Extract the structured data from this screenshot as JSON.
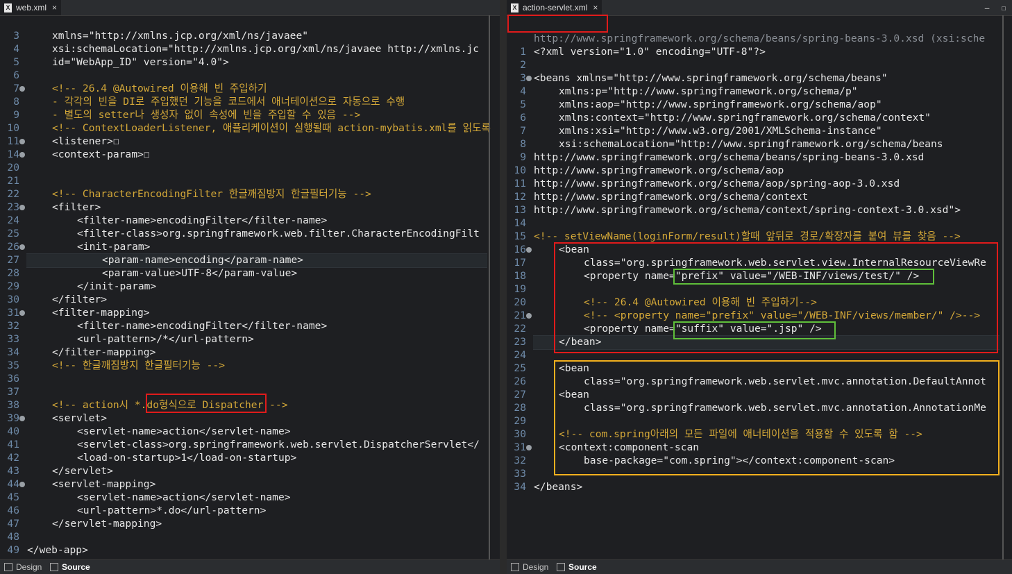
{
  "left": {
    "tab": {
      "label": "web.xml",
      "close": "×"
    },
    "bottom_tabs": {
      "design": "Design",
      "source": "Source"
    },
    "lines": [
      {
        "n": "3",
        "fold": false,
        "indent": 4,
        "text": "xmlns=\"http://xmlns.jcp.org/xml/ns/javaee\"",
        "kind": "tag"
      },
      {
        "n": "4",
        "fold": false,
        "indent": 4,
        "text": "xsi:schemaLocation=\"http://xmlns.jcp.org/xml/ns/javaee http://xmlns.jc",
        "kind": "tag"
      },
      {
        "n": "5",
        "fold": false,
        "indent": 4,
        "text": "id=\"WebApp_ID\" version=\"4.0\">",
        "kind": "tag"
      },
      {
        "n": "6",
        "fold": false,
        "indent": 0,
        "text": "",
        "kind": "tag"
      },
      {
        "n": "7",
        "fold": true,
        "indent": 4,
        "text": "<!-- 26.4 @Autowired 이용해 빈 주입하기",
        "kind": "cmt"
      },
      {
        "n": "8",
        "fold": false,
        "indent": 4,
        "text": "- 각각의 빈을 DI로 주입했던 기능을 코드에서 애너테이션으로 자동으로 수행",
        "kind": "cmt"
      },
      {
        "n": "9",
        "fold": false,
        "indent": 4,
        "text": "- 별도의 setter나 생성자 없이 속성에 빈을 주입할 수 있음 -->",
        "kind": "cmt"
      },
      {
        "n": "10",
        "fold": false,
        "indent": 4,
        "text": "<!-- ContextLoaderListener, 애플리케이션이 실행될때 action-mybatis.xml를 읽도록",
        "kind": "cmt"
      },
      {
        "n": "11",
        "fold": "plus",
        "indent": 4,
        "text": "<listener>☐",
        "kind": "tag"
      },
      {
        "n": "14",
        "fold": "plus",
        "indent": 4,
        "text": "<context-param>☐",
        "kind": "tag"
      },
      {
        "n": "20",
        "fold": false,
        "indent": 0,
        "text": "",
        "kind": "tag"
      },
      {
        "n": "21",
        "fold": false,
        "indent": 0,
        "text": "",
        "kind": "tag"
      },
      {
        "n": "22",
        "fold": false,
        "indent": 4,
        "text": "<!-- CharacterEncodingFilter 한글깨짐방지 한글필터기능 -->",
        "kind": "cmt"
      },
      {
        "n": "23",
        "fold": true,
        "indent": 4,
        "text": "<filter>",
        "kind": "tag"
      },
      {
        "n": "24",
        "fold": false,
        "indent": 8,
        "text": "<filter-name>encodingFilter</filter-name>",
        "kind": "tag"
      },
      {
        "n": "25",
        "fold": false,
        "indent": 8,
        "text": "<filter-class>org.springframework.web.filter.CharacterEncodingFilt",
        "kind": "tag"
      },
      {
        "n": "26",
        "fold": true,
        "indent": 8,
        "text": "<init-param>",
        "kind": "tag"
      },
      {
        "n": "27",
        "fold": false,
        "indent": 12,
        "text": "<param-name>encoding</param-name>",
        "kind": "tag",
        "current": true
      },
      {
        "n": "28",
        "fold": false,
        "indent": 12,
        "text": "<param-value>UTF-8</param-value>",
        "kind": "tag"
      },
      {
        "n": "29",
        "fold": false,
        "indent": 8,
        "text": "</init-param>",
        "kind": "tag"
      },
      {
        "n": "30",
        "fold": false,
        "indent": 4,
        "text": "</filter>",
        "kind": "tag"
      },
      {
        "n": "31",
        "fold": true,
        "indent": 4,
        "text": "<filter-mapping>",
        "kind": "tag"
      },
      {
        "n": "32",
        "fold": false,
        "indent": 8,
        "text": "<filter-name>encodingFilter</filter-name>",
        "kind": "tag"
      },
      {
        "n": "33",
        "fold": false,
        "indent": 8,
        "text": "<url-pattern>/*</url-pattern>",
        "kind": "tag"
      },
      {
        "n": "34",
        "fold": false,
        "indent": 4,
        "text": "</filter-mapping>",
        "kind": "tag"
      },
      {
        "n": "35",
        "fold": false,
        "indent": 4,
        "text": "<!-- 한글깨짐방지 한글필터기능 -->",
        "kind": "cmt"
      },
      {
        "n": "36",
        "fold": false,
        "indent": 0,
        "text": "",
        "kind": "tag"
      },
      {
        "n": "37",
        "fold": false,
        "indent": 0,
        "text": "",
        "kind": "tag"
      },
      {
        "n": "38",
        "fold": false,
        "indent": 4,
        "text": "<!-- action시 *.do형식으로 Dispatcher -->",
        "kind": "cmt"
      },
      {
        "n": "39",
        "fold": true,
        "indent": 4,
        "text": "<servlet>",
        "kind": "tag"
      },
      {
        "n": "40",
        "fold": false,
        "indent": 8,
        "text": "<servlet-name>action</servlet-name>",
        "kind": "tag"
      },
      {
        "n": "41",
        "fold": false,
        "indent": 8,
        "text": "<servlet-class>org.springframework.web.servlet.DispatcherServlet</",
        "kind": "tag"
      },
      {
        "n": "42",
        "fold": false,
        "indent": 8,
        "text": "<load-on-startup>1</load-on-startup>",
        "kind": "tag"
      },
      {
        "n": "43",
        "fold": false,
        "indent": 4,
        "text": "</servlet>",
        "kind": "tag"
      },
      {
        "n": "44",
        "fold": true,
        "indent": 4,
        "text": "<servlet-mapping>",
        "kind": "tag"
      },
      {
        "n": "45",
        "fold": false,
        "indent": 8,
        "text": "<servlet-name>action</servlet-name>",
        "kind": "tag"
      },
      {
        "n": "46",
        "fold": false,
        "indent": 8,
        "text": "<url-pattern>*.do</url-pattern>",
        "kind": "tag"
      },
      {
        "n": "47",
        "fold": false,
        "indent": 4,
        "text": "</servlet-mapping>",
        "kind": "tag"
      },
      {
        "n": "48",
        "fold": false,
        "indent": 0,
        "text": "",
        "kind": "tag"
      },
      {
        "n": "49",
        "fold": false,
        "indent": 0,
        "text": "</web-app>",
        "kind": "tag"
      }
    ]
  },
  "right": {
    "tab": {
      "label": "action-servlet.xml",
      "close": "×"
    },
    "bottom_tabs": {
      "design": "Design",
      "source": "Source"
    },
    "header_line": "http://www.springframework.org/schema/beans/spring-beans-3.0.xsd (xsi:sche",
    "lines": [
      {
        "n": "1",
        "fold": false,
        "indent": 0,
        "text": "<?xml version=\"1.0\" encoding=\"UTF-8\"?>",
        "kind": "tag"
      },
      {
        "n": "2",
        "fold": false,
        "indent": 0,
        "text": "",
        "kind": "tag"
      },
      {
        "n": "3",
        "fold": true,
        "indent": 0,
        "text": "<beans xmlns=\"http://www.springframework.org/schema/beans\"",
        "kind": "tag"
      },
      {
        "n": "4",
        "fold": false,
        "indent": 4,
        "text": "xmlns:p=\"http://www.springframework.org/schema/p\"",
        "kind": "tag"
      },
      {
        "n": "5",
        "fold": false,
        "indent": 4,
        "text": "xmlns:aop=\"http://www.springframework.org/schema/aop\"",
        "kind": "tag"
      },
      {
        "n": "6",
        "fold": false,
        "indent": 4,
        "text": "xmlns:context=\"http://www.springframework.org/schema/context\"",
        "kind": "tag"
      },
      {
        "n": "7",
        "fold": false,
        "indent": 4,
        "text": "xmlns:xsi=\"http://www.w3.org/2001/XMLSchema-instance\"",
        "kind": "tag"
      },
      {
        "n": "8",
        "fold": false,
        "indent": 4,
        "text": "xsi:schemaLocation=\"http://www.springframework.org/schema/beans",
        "kind": "tag"
      },
      {
        "n": "9",
        "fold": false,
        "indent": 0,
        "text": "http://www.springframework.org/schema/beans/spring-beans-3.0.xsd",
        "kind": "tag"
      },
      {
        "n": "10",
        "fold": false,
        "indent": 0,
        "text": "http://www.springframework.org/schema/aop",
        "kind": "tag"
      },
      {
        "n": "11",
        "fold": false,
        "indent": 0,
        "text": "http://www.springframework.org/schema/aop/spring-aop-3.0.xsd",
        "kind": "tag"
      },
      {
        "n": "12",
        "fold": false,
        "indent": 0,
        "text": "http://www.springframework.org/schema/context",
        "kind": "tag"
      },
      {
        "n": "13",
        "fold": false,
        "indent": 0,
        "text": "http://www.springframework.org/schema/context/spring-context-3.0.xsd\">",
        "kind": "tag"
      },
      {
        "n": "14",
        "fold": false,
        "indent": 0,
        "text": "",
        "kind": "tag"
      },
      {
        "n": "15",
        "fold": false,
        "indent": 0,
        "text": "<!-- setViewName(loginForm/result)할때 앞뒤로 경로/확장자를 붙여 뷰를 찾음 -->",
        "kind": "cmt"
      },
      {
        "n": "16",
        "fold": true,
        "indent": 4,
        "text": "<bean",
        "kind": "tag"
      },
      {
        "n": "17",
        "fold": false,
        "indent": 8,
        "text": "class=\"org.springframework.web.servlet.view.InternalResourceViewRe",
        "kind": "tag"
      },
      {
        "n": "18",
        "fold": false,
        "indent": 8,
        "text": "<property name=\"prefix\" value=\"/WEB-INF/views/test/\" />",
        "kind": "tag"
      },
      {
        "n": "19",
        "fold": false,
        "indent": 0,
        "text": "",
        "kind": "tag"
      },
      {
        "n": "20",
        "fold": false,
        "indent": 8,
        "text": "<!-- 26.4 @Autowired 이용해 빈 주입하기-->",
        "kind": "cmt"
      },
      {
        "n": "21",
        "fold": true,
        "indent": 8,
        "text": "<!-- <property name=\"prefix\" value=\"/WEB-INF/views/member/\" />-->",
        "kind": "cmt"
      },
      {
        "n": "22",
        "fold": false,
        "indent": 8,
        "text": "<property name=\"suffix\" value=\".jsp\" />",
        "kind": "tag"
      },
      {
        "n": "23",
        "fold": false,
        "indent": 4,
        "text": "</bean>",
        "kind": "tag",
        "current": true
      },
      {
        "n": "24",
        "fold": false,
        "indent": 0,
        "text": "",
        "kind": "tag"
      },
      {
        "n": "25",
        "fold": false,
        "indent": 4,
        "text": "<bean",
        "kind": "tag"
      },
      {
        "n": "26",
        "fold": false,
        "indent": 8,
        "text": "class=\"org.springframework.web.servlet.mvc.annotation.DefaultAnnot",
        "kind": "tag"
      },
      {
        "n": "27",
        "fold": false,
        "indent": 4,
        "text": "<bean",
        "kind": "tag"
      },
      {
        "n": "28",
        "fold": false,
        "indent": 8,
        "text": "class=\"org.springframework.web.servlet.mvc.annotation.AnnotationMe",
        "kind": "tag"
      },
      {
        "n": "29",
        "fold": false,
        "indent": 0,
        "text": "",
        "kind": "tag"
      },
      {
        "n": "30",
        "fold": false,
        "indent": 4,
        "text": "<!-- com.spring아래의 모든 파일에 애너테이션을 적용할 수 있도록 함 -->",
        "kind": "cmt"
      },
      {
        "n": "31",
        "fold": true,
        "indent": 4,
        "text": "<context:component-scan",
        "kind": "tag"
      },
      {
        "n": "32",
        "fold": false,
        "indent": 8,
        "text": "base-package=\"com.spring\"></context:component-scan>",
        "kind": "tag"
      },
      {
        "n": "33",
        "fold": false,
        "indent": 0,
        "text": "",
        "kind": "tag"
      },
      {
        "n": "34",
        "fold": false,
        "indent": 0,
        "text": "</beans>",
        "kind": "tag"
      }
    ]
  },
  "window_buttons": {
    "minimize": "—",
    "maximize": "☐"
  },
  "colors": {
    "highlight_red": "#e01b1b",
    "highlight_green": "#5fbf3a",
    "highlight_yellow": "#f2b01e",
    "comment": "#d4a838"
  }
}
